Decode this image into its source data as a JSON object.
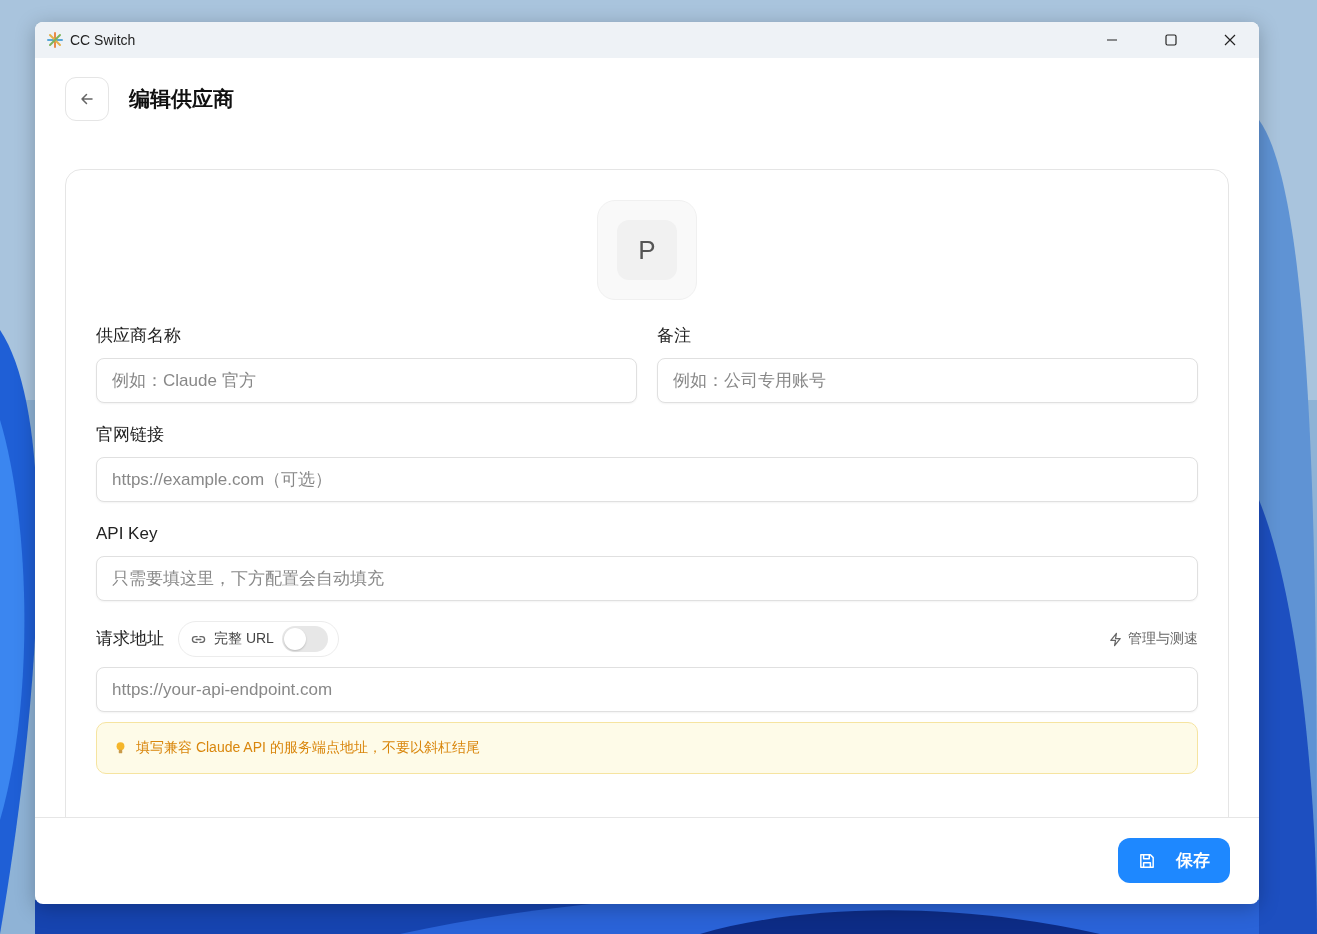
{
  "window": {
    "title": "CC Switch"
  },
  "header": {
    "title": "编辑供应商"
  },
  "avatar": {
    "letter": "P"
  },
  "pair": [
    {
      "label": "供应商名称",
      "placeholder": "例如：Claude 官方"
    },
    {
      "label": "备注",
      "placeholder": "例如：公司专用账号"
    }
  ],
  "website": {
    "label": "官网链接",
    "placeholder": "https://example.com（可选）"
  },
  "api_key": {
    "label": "API Key",
    "placeholder": "只需要填这里，下方配置会自动填充"
  },
  "endpoint": {
    "label": "请求地址",
    "toggle": {
      "label": "完整 URL",
      "on": false
    },
    "manage_link": "管理与测速",
    "placeholder": "https://your-api-endpoint.com",
    "hint": "填写兼容 Claude API 的服务端点地址，不要以斜杠结尾"
  },
  "footer": {
    "save": "保存"
  }
}
